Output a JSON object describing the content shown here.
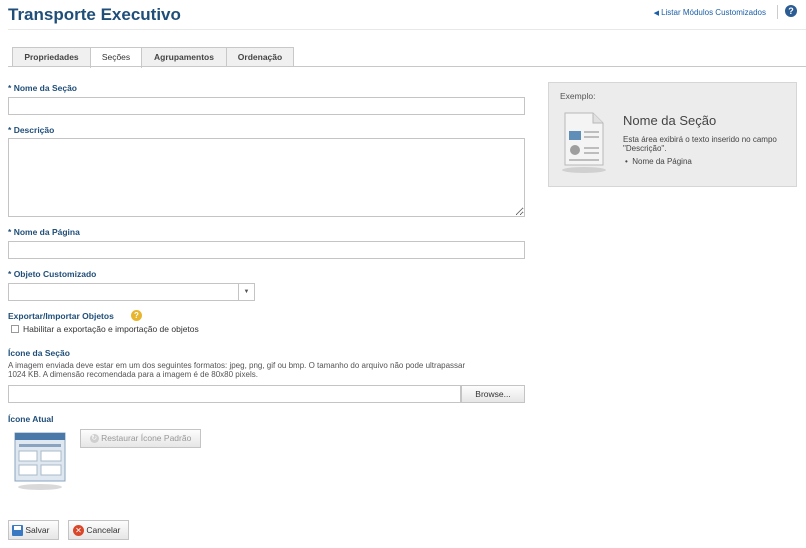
{
  "header": {
    "title": "Transporte Executivo",
    "back_link": "Listar Módulos Customizados",
    "help_icon": "?"
  },
  "tabs": [
    {
      "label": "Propriedades",
      "active": false
    },
    {
      "label": "Seções",
      "active": true
    },
    {
      "label": "Agrupamentos",
      "active": false
    },
    {
      "label": "Ordenação",
      "active": false
    }
  ],
  "form": {
    "section_name": {
      "label": "Nome da Seção",
      "value": ""
    },
    "description": {
      "label": "Descrição",
      "value": ""
    },
    "page_name": {
      "label": "Nome da Página",
      "value": ""
    },
    "custom_object": {
      "label": "Objeto Customizado",
      "value": ""
    },
    "export_import": {
      "label": "Exportar/Importar Objetos",
      "checkbox_label": "Habilitar a exportação e importação de objetos",
      "checked": false
    },
    "section_icon": {
      "label": "Ícone da Seção",
      "description_line1": "A imagem enviada deve estar em um dos seguintes formatos: jpeg, png, gif ou bmp. O tamanho do arquivo não pode ultrapassar",
      "description_line2": "1024 KB. A dimensão recomendada para a imagem é de 80x80 pixels.",
      "browse_label": "Browse..."
    },
    "current_icon": {
      "label": "Ícone Atual",
      "restore_label": "Restaurar Ícone Padrão"
    },
    "required_marker": "*"
  },
  "example": {
    "label": "Exemplo:",
    "title": "Nome da Seção",
    "text_line1": "Esta área exibirá o texto inserido no campo",
    "text_line2": "\"Descrição\".",
    "bullet": "Nome da Página"
  },
  "actions": {
    "save_label": "Salvar",
    "cancel_label": "Cancelar"
  },
  "colors": {
    "title": "#1f4e79",
    "link": "#1a5fa8",
    "cancel_icon": "#d9472b",
    "save_icon": "#3a78c2"
  }
}
